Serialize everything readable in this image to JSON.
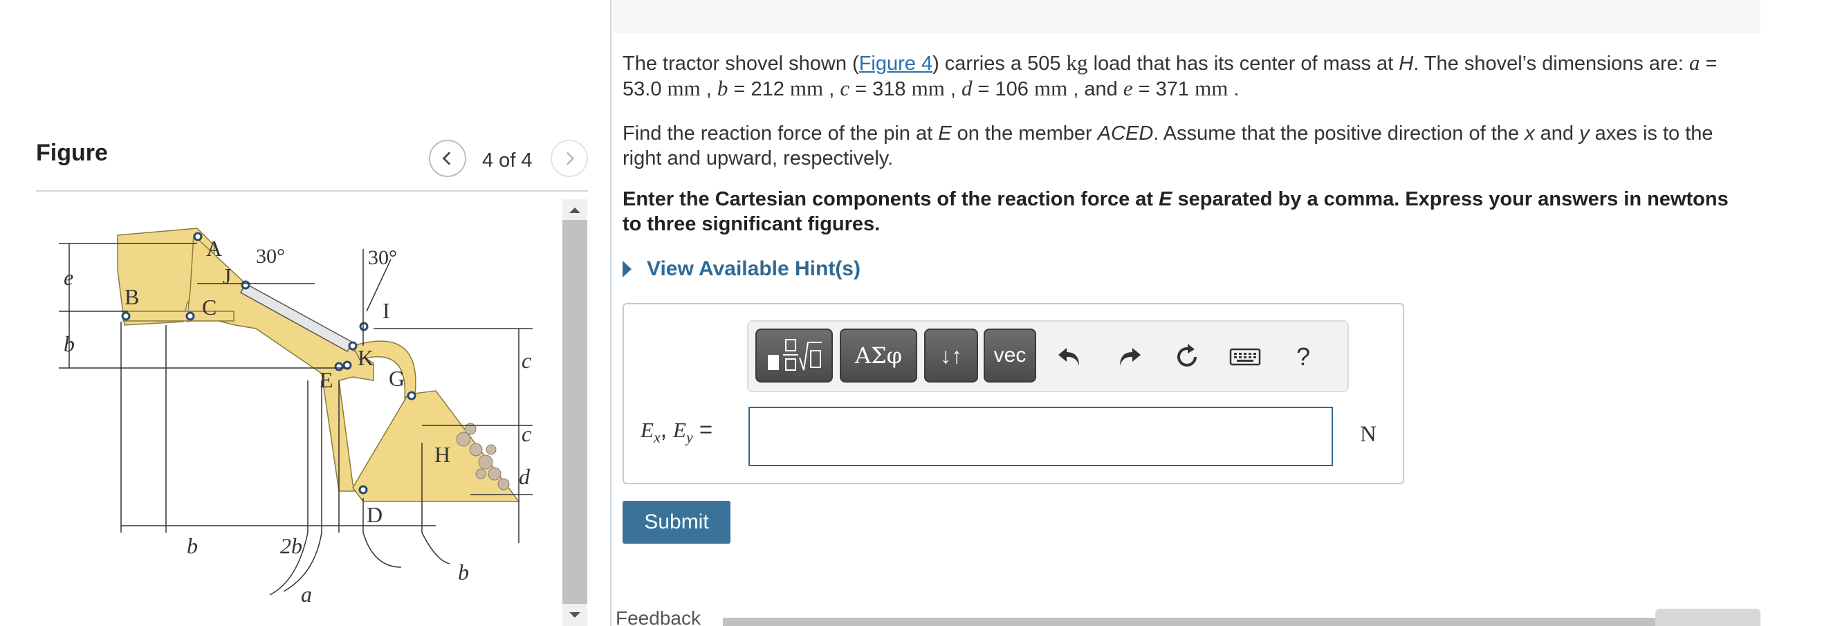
{
  "figure_panel": {
    "title": "Figure",
    "counter": "4 of 4",
    "labels": {
      "A": "A",
      "B": "B",
      "C": "C",
      "D": "D",
      "E": "E",
      "G": "G",
      "H": "H",
      "I": "I",
      "J": "J",
      "K": "K",
      "e": "e",
      "b_left": "b",
      "c_top": "c",
      "c_mid": "c",
      "d": "d",
      "b_bottom": "b",
      "two_b": "2b",
      "a": "a",
      "b_right": "b",
      "angle_left": "30°",
      "angle_right": "30°"
    }
  },
  "problem": {
    "p1_pre": "The tractor shovel shown (",
    "p1_link": "Figure 4",
    "p1_mid": ") carries a 505 ",
    "p1_kg": "kg",
    "p1_post": " load that has its center of mass at ",
    "H": "H",
    "p1_dims": ". The shovel’s dimensions are: ",
    "a_sym": "a",
    "a_val": " = 53.0 ",
    "mm1": "mm",
    "b_sym": "b",
    "b_val": " = 212 ",
    "mm2": "mm",
    "c_sym": "c",
    "c_val": " = 318 ",
    "mm3": "mm",
    "d_sym": "d",
    "d_val": " = 106 ",
    "mm4": "mm",
    "and": " , and ",
    "e_sym": "e",
    "e_val": " = 371 ",
    "mm5": "mm",
    "sep": " , ",
    "end": " .",
    "p2_pre": "Find the reaction force of the pin at ",
    "E": "E",
    "p2_mid": " on the member ",
    "ACED": "ACED",
    "p2_mid2": ". Assume that the positive direction of the ",
    "x": "x",
    "p2_and": " and ",
    "y": "y",
    "p2_post": " axes is to the right and upward, respectively.",
    "p3_pre": "Enter the Cartesian components of the reaction force at ",
    "p3_post": " separated by a comma. Express your answers  in newtons to three significant figures."
  },
  "hint": {
    "label": "View Available Hint(s)"
  },
  "toolbar": {
    "greek_label": "ΑΣφ",
    "updown_label": "↓↑",
    "vec_label": "vec",
    "help_label": "?"
  },
  "answer": {
    "label_Ex": "E",
    "sub_x": "x",
    "comma": ",",
    "label_Ey": "E",
    "sub_y": "y",
    "eq": " =",
    "value": "",
    "unit": "N"
  },
  "submit": {
    "label": "Submit"
  },
  "feedback_partial": "Feedback"
}
